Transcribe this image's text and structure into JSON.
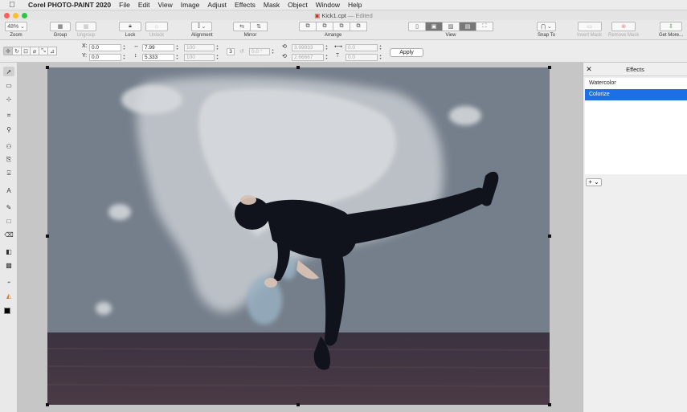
{
  "menubar": {
    "app": "Corel PHOTO-PAINT 2020",
    "items": [
      "File",
      "Edit",
      "View",
      "Image",
      "Adjust",
      "Effects",
      "Mask",
      "Object",
      "Window",
      "Help"
    ]
  },
  "window": {
    "title": "Kick1.cpt",
    "status": "— Edited"
  },
  "toolbar": {
    "zoom_value": "48%",
    "zoom": "Zoom",
    "group": "Group",
    "ungroup": "Ungroup",
    "lock": "Lock",
    "unlock": "Unlock",
    "alignment": "Alignment",
    "mirror": "Mirror",
    "arrange": "Arrange",
    "view": "View",
    "snap_to": "Snap To",
    "invert_mask": "Invert Mask",
    "remove_mask": "Remove Mask",
    "get_more": "Get More..."
  },
  "propbar": {
    "x_label": "X:",
    "x_value": "0.0",
    "y_label": "Y:",
    "y_value": "0.0",
    "w_value": "7.99",
    "h_value": "5.333",
    "sw_value": "100",
    "sh_value": "100",
    "lock_value": "3",
    "angle_value": "0.0 °",
    "cx_value": "3.99933",
    "cy_value": "2.66667",
    "skew_h": "0.0",
    "skew_v": "0.0",
    "apply": "Apply"
  },
  "effects": {
    "title": "Effects",
    "items": [
      {
        "label": "Watercolor",
        "selected": false
      },
      {
        "label": "Colorize",
        "selected": true
      }
    ],
    "add_label": "+ ⌄"
  },
  "colors": {
    "selection": "#1d6fe8",
    "close": "#ff5f57",
    "min": "#febc2e",
    "max": "#28c840"
  }
}
